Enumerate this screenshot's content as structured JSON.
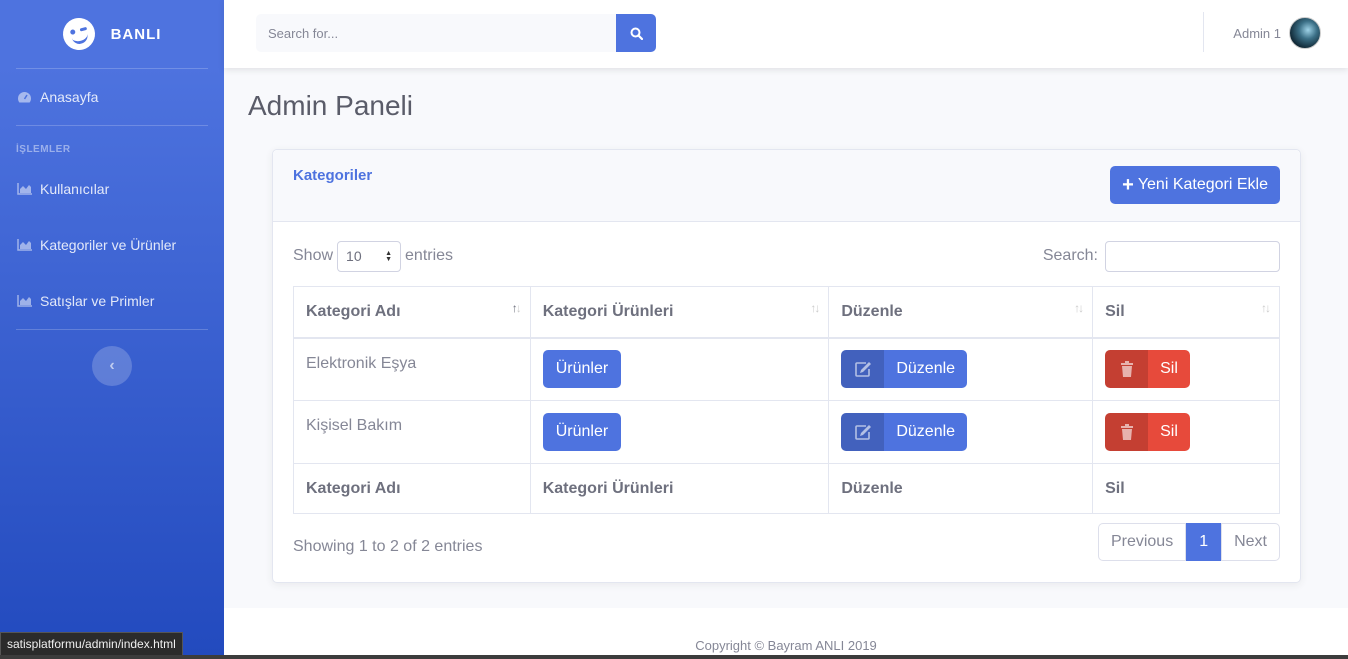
{
  "brand": {
    "name": "BANLI"
  },
  "sidebar": {
    "dashboard": "Anasayfa",
    "heading": "İŞLEMLER",
    "items": [
      {
        "label": "Kullanıcılar",
        "icon": "chart-area-icon"
      },
      {
        "label": "Kategoriler ve Ürünler",
        "icon": "chart-area-icon"
      },
      {
        "label": "Satışlar ve Primler",
        "icon": "chart-area-icon"
      }
    ],
    "toggle_glyph": "‹"
  },
  "topbar": {
    "search_placeholder": "Search for...",
    "user_name": "Admin 1"
  },
  "page": {
    "title": "Admin Paneli"
  },
  "card": {
    "title": "Kategoriler",
    "add_button": "Yeni Kategori Ekle"
  },
  "datatable": {
    "show_label": "Show",
    "page_length": "10",
    "entries_label": "entries",
    "search_label": "Search:",
    "columns": [
      "Kategori Adı",
      "Kategori Ürünleri",
      "Düzenle",
      "Sil"
    ],
    "rows": [
      {
        "name": "Elektronik Eşya",
        "products_btn": "Ürünler",
        "edit_btn": "Düzenle",
        "delete_btn": "Sil"
      },
      {
        "name": "Kişisel Bakım",
        "products_btn": "Ürünler",
        "edit_btn": "Düzenle",
        "delete_btn": "Sil"
      }
    ],
    "info": "Showing 1 to 2 of 2 entries",
    "pagination": {
      "previous": "Previous",
      "current": "1",
      "next": "Next"
    }
  },
  "footer": {
    "copyright": "Copyright © Bayram ANLI 2019"
  },
  "status_bar": {
    "url": "satisplatformu/admin/index.html"
  },
  "colors": {
    "primary": "#4e73df",
    "danger": "#e74a3b"
  }
}
